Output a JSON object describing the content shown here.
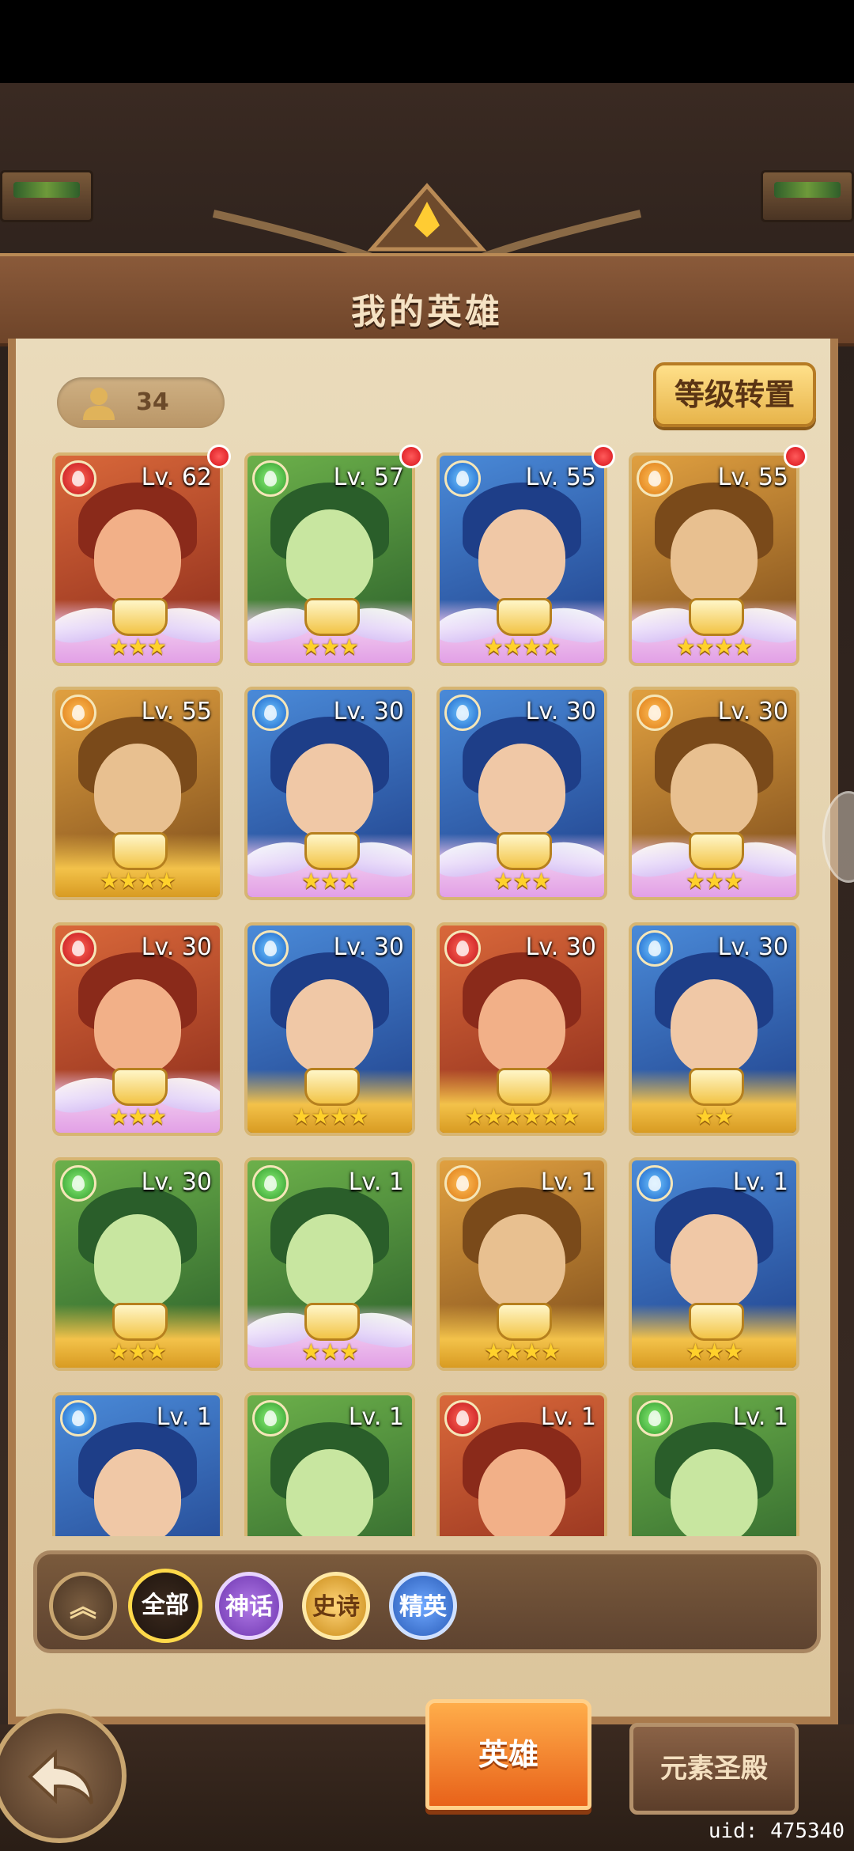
{
  "header": {
    "title": "我的英雄"
  },
  "hero_count": {
    "value": "34",
    "icon": "person-icon"
  },
  "actions": {
    "level_transfer_label": "等级转置"
  },
  "heroes": [
    {
      "level": "Lv. 62",
      "element": "fire",
      "stars": "★★★",
      "new": true,
      "style": "wings"
    },
    {
      "level": "Lv. 57",
      "element": "wind",
      "stars": "★★★",
      "new": true,
      "style": "wings"
    },
    {
      "level": "Lv. 55",
      "element": "water",
      "stars": "★★★★",
      "new": true,
      "style": "wings"
    },
    {
      "level": "Lv. 55",
      "element": "earth",
      "stars": "★★★★",
      "new": true,
      "style": "wings"
    },
    {
      "level": "Lv. 55",
      "element": "earth",
      "stars": "★★★★",
      "new": false,
      "style": "gold"
    },
    {
      "level": "Lv. 30",
      "element": "water",
      "stars": "★★★",
      "new": false,
      "style": "wings"
    },
    {
      "level": "Lv. 30",
      "element": "water",
      "stars": "★★★",
      "new": false,
      "style": "wings"
    },
    {
      "level": "Lv. 30",
      "element": "earth",
      "stars": "★★★",
      "new": false,
      "style": "wings"
    },
    {
      "level": "Lv. 30",
      "element": "fire",
      "stars": "★★★",
      "new": false,
      "style": "wings"
    },
    {
      "level": "Lv. 30",
      "element": "water",
      "stars": "★★★★",
      "new": false,
      "style": "gold"
    },
    {
      "level": "Lv. 30",
      "element": "fire",
      "stars": "★★★★★★",
      "new": false,
      "style": "gold"
    },
    {
      "level": "Lv. 30",
      "element": "water",
      "stars": "★★",
      "new": false,
      "style": "gold"
    },
    {
      "level": "Lv. 30",
      "element": "wind",
      "stars": "★★★",
      "new": false,
      "style": "gold"
    },
    {
      "level": "Lv. 1",
      "element": "wind",
      "stars": "★★★",
      "new": false,
      "style": "wings"
    },
    {
      "level": "Lv. 1",
      "element": "earth",
      "stars": "★★★★",
      "new": false,
      "style": "gold"
    },
    {
      "level": "Lv. 1",
      "element": "water",
      "stars": "★★★",
      "new": false,
      "style": "gold"
    },
    {
      "level": "Lv. 1",
      "element": "water",
      "stars": "",
      "new": false,
      "style": "gold"
    },
    {
      "level": "Lv. 1",
      "element": "wind",
      "stars": "",
      "new": false,
      "style": "gold"
    },
    {
      "level": "Lv. 1",
      "element": "fire",
      "stars": "",
      "new": false,
      "style": "gold"
    },
    {
      "level": "Lv. 1",
      "element": "wind",
      "stars": "",
      "new": false,
      "style": "gold"
    }
  ],
  "filters": {
    "all": "全部",
    "myth": "神话",
    "epic": "史诗",
    "elite": "精英"
  },
  "tabs": {
    "heroes": "英雄",
    "elemental_temple": "元素圣殿"
  },
  "footer": {
    "uid": "uid: 475340"
  },
  "colors": {
    "panel": "#eadbbb",
    "accent_orange": "#e8621a",
    "star_gold": "#ffd12b",
    "element_fire": "#c2131a",
    "element_wind": "#2e9a2a",
    "element_water": "#1860c8",
    "element_earth": "#dd7a14"
  }
}
